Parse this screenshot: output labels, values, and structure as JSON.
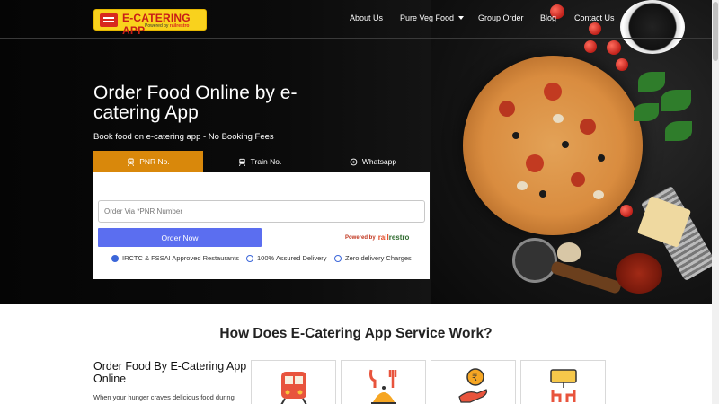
{
  "nav": {
    "logo_title": "E-CATERING APP",
    "logo_sub_prefix": "Powered by",
    "logo_sub_brand": "railrestro",
    "items": [
      {
        "label": "About Us"
      },
      {
        "label": "Pure Veg Food"
      },
      {
        "label": "Group Order"
      },
      {
        "label": "Blog"
      },
      {
        "label": "Contact Us"
      }
    ]
  },
  "hero": {
    "title": "Order Food Online by e-catering App",
    "subtitle": "Book food on e-catering app - No Booking Fees"
  },
  "tabs": [
    {
      "label": "PNR No.",
      "icon": "train-icon",
      "active": true
    },
    {
      "label": "Train No.",
      "icon": "train-front-icon",
      "active": false
    },
    {
      "label": "Whatsapp",
      "icon": "whatsapp-icon",
      "active": false
    }
  ],
  "form": {
    "pnr_placeholder": "Order Via *PNR Number",
    "order_button": "Order Now",
    "powered_by": "Powered by",
    "powered_brand_a": "rail",
    "powered_brand_b": "restro"
  },
  "features": [
    {
      "label": "IRCTC & FSSAI Approved Restaurants",
      "icon": "check-badge-icon"
    },
    {
      "label": "100% Assured Delivery",
      "icon": "clock-icon"
    },
    {
      "label": "Zero delivery Charges",
      "icon": "magnifier-icon"
    }
  ],
  "section": {
    "title": "How Does E-Catering App Service Work?",
    "left_heading": "Order Food By E-Catering App Online",
    "left_text": "When your hunger craves delicious food during"
  },
  "steps": [
    {
      "icon": "train-icon"
    },
    {
      "icon": "food-serving-icon"
    },
    {
      "icon": "payment-hand-icon"
    },
    {
      "icon": "seat-delivery-icon"
    }
  ],
  "colors": {
    "accent_orange": "#d9880b",
    "button_blue": "#5b6ef0",
    "logo_yellow": "#f9d21d",
    "brand_red": "#d8281f"
  }
}
